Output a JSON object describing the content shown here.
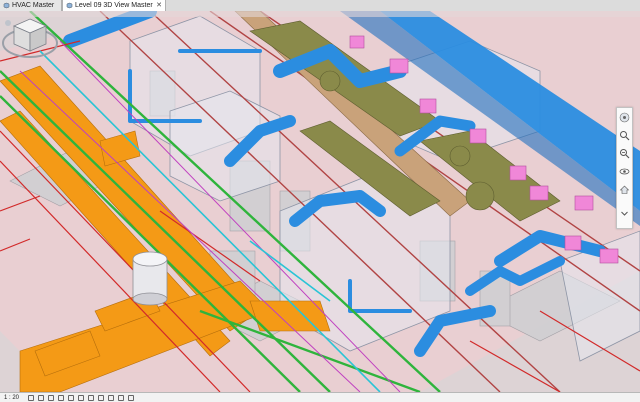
{
  "tabs": [
    {
      "label": "HVAC Master",
      "active": false
    },
    {
      "label": "Level 09 3D View Master",
      "active": true
    }
  ],
  "status": {
    "scale": "1 : 20"
  },
  "icons": {
    "tab": "3d-view-icon",
    "close": "close-icon",
    "viewcube": "viewcube-icon",
    "house": "home-icon",
    "wheel": "steering-wheel-icon",
    "zoom": "zoom-icon",
    "orbit": "orbit-icon"
  },
  "colors": {
    "duct_blue": "#2b8de0",
    "duct_olive": "#8a8a4a",
    "pipe_orange": "#f49a16",
    "pipe_green": "#2fb43c",
    "pipe_red": "#d22a2a",
    "fitting_pink": "#f087d8",
    "floor": "#e9cfd2",
    "beam_tan": "#c9a27a"
  }
}
